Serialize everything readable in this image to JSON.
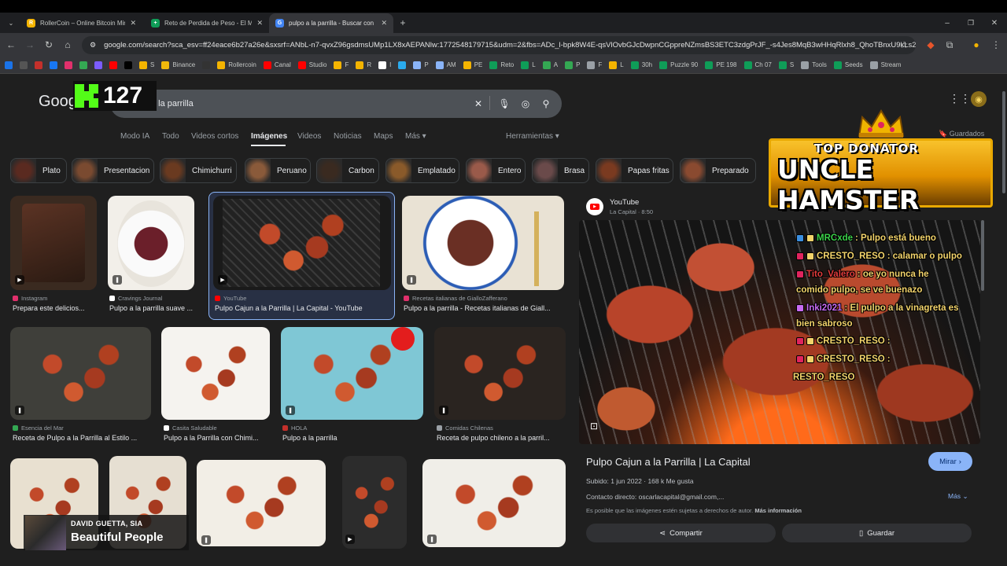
{
  "browser": {
    "tabs": [
      {
        "title": "RollerCoin – Online Bitcoin Mining",
        "color": "#f4b400",
        "glyph": "R"
      },
      {
        "title": "Reto de Perdida de Peso - El M",
        "color": "#0f9d58",
        "glyph": "+"
      },
      {
        "title": "pulpo a la parrilla - Buscar con",
        "color": "#4285f4",
        "glyph": "G"
      }
    ],
    "url": "google.com/search?sca_esv=ff24eace6b27a26e&sxsrf=ANbL-n7-qvxZ96gsdmsUMp1LX8xAEPANlw:1772548179715&udm=2&fbs=ADc_l-bpk8W4E-qsVlOvbGJcDwpnCGppreNZmsBS3ETC3zdgPrJF_-s4Jes8MqB3wHHqRlxh8_QhoTBnxU9kLs26Wf...",
    "bookmarks": [
      {
        "label": "",
        "color": "#1a73e8"
      },
      {
        "label": "",
        "color": "#555"
      },
      {
        "label": "",
        "color": "#c4302b"
      },
      {
        "label": "",
        "color": "#1877f2"
      },
      {
        "label": "",
        "color": "#e1306c"
      },
      {
        "label": "",
        "color": "#34a853"
      },
      {
        "label": "",
        "color": "#7b5cff"
      },
      {
        "label": "",
        "color": "#ff0000"
      },
      {
        "label": "",
        "color": "#000"
      },
      {
        "label": "S",
        "color": "#f4b400"
      },
      {
        "label": "Binance",
        "color": "#f0b90b"
      },
      {
        "label": "",
        "color": "#333"
      },
      {
        "label": "Rollercoin",
        "color": "#f4b400"
      },
      {
        "label": "Canal",
        "color": "#ff0000"
      },
      {
        "label": "Studio",
        "color": "#ff0000"
      },
      {
        "label": "F",
        "color": "#f4b400"
      },
      {
        "label": "R",
        "color": "#f4b400"
      },
      {
        "label": "I",
        "color": "#ffffff"
      },
      {
        "label": "",
        "color": "#2aabee"
      },
      {
        "label": "P",
        "color": "#8ab4f8"
      },
      {
        "label": "AM",
        "color": "#8ab4f8"
      },
      {
        "label": "PE",
        "color": "#f4b400"
      },
      {
        "label": "Reto",
        "color": "#0f9d58"
      },
      {
        "label": "L",
        "color": "#0f9d58"
      },
      {
        "label": "A",
        "color": "#34a853"
      },
      {
        "label": "P",
        "color": "#34a853"
      },
      {
        "label": "F",
        "color": "#9aa0a6"
      },
      {
        "label": "L",
        "color": "#f4b400"
      },
      {
        "label": "30h",
        "color": "#0f9d58"
      },
      {
        "label": "Puzzle 90",
        "color": "#0f9d58"
      },
      {
        "label": "PE 198",
        "color": "#0f9d58"
      },
      {
        "label": "Ch 07",
        "color": "#0f9d58"
      },
      {
        "label": "S",
        "color": "#0f9d58"
      },
      {
        "label": "Tools",
        "color": "#9aa0a6"
      },
      {
        "label": "Seeds",
        "color": "#0f9d58"
      },
      {
        "label": "Stream",
        "color": "#9aa0a6"
      }
    ]
  },
  "google": {
    "logo": "Goog",
    "query": "pulpo a la parrilla",
    "tabs": [
      "Modo IA",
      "Todo",
      "Videos cortos",
      "Imágenes",
      "Videos",
      "Noticias",
      "Maps",
      "Más ▾"
    ],
    "tools": "Herramientas ▾",
    "saved": "Guardados",
    "chips": [
      "Plato",
      "Presentacion",
      "Chimichurri",
      "Peruano",
      "Carbon",
      "Emplatado",
      "Entero",
      "Brasa",
      "Papas fritas",
      "Preparado"
    ]
  },
  "results": [
    {
      "source": "Instagram",
      "caption": "Prepara este delicios...",
      "src_color": "#e1306c"
    },
    {
      "source": "Cravings Journal",
      "caption": "Pulpo a la parrilla suave ...",
      "src_color": "#ffffff"
    },
    {
      "source": "YouTube",
      "caption": "Pulpo Cajun a la Parrilla | La Capital - YouTube",
      "src_color": "#ff0000"
    },
    {
      "source": "Recetas italianas de GialloZafferano",
      "caption": "Pulpo a la parrilla - Recetas italianas de Giall...",
      "src_color": "#e1306c"
    },
    {
      "source": "Esencia del Mar",
      "caption": "Receta de Pulpo a la Parrilla al Estilo ...",
      "src_color": "#34a853"
    },
    {
      "source": "Casita Saludable",
      "caption": "Pulpo a la Parrilla con Chimi...",
      "src_color": "#ffffff"
    },
    {
      "source": "HOLA",
      "caption": "Pulpo a la parrilla",
      "src_color": "#c4302b"
    },
    {
      "source": "Comidas Chilenas",
      "caption": "Receta de pulpo chileno a la parril...",
      "src_color": "#9aa0a6"
    }
  ],
  "panel": {
    "source": "YouTube",
    "channel": "La Capital · 8:50",
    "title": "Pulpo Cajun a la Parrilla | La Capital",
    "visit": "Mirar",
    "meta": "Subido:  1 jun 2022  ·  168 k Me gusta",
    "contact": "Contacto directo: oscarlacapital@gmail.com,...",
    "more": "Más",
    "disclaimer": "Es posible que las imágenes estén sujetas a derechos de autor.",
    "disclaimer_link": "Más información",
    "share": "Compartir",
    "save": "Guardar"
  },
  "chat": [
    {
      "user": "MRCxde",
      "msg": ": Pulpo está bueno",
      "user_color": "#3bd14a"
    },
    {
      "user": "CRESTO_RESO",
      "msg": ": calamar o pulpo",
      "user_color": "#f2d36b"
    },
    {
      "user": "Tito_Valero",
      "msg": ": oe yo nunca he",
      "user_color": "#e33b3b"
    },
    {
      "user": "",
      "msg": "comido pulpo, se ve buenazo",
      "user_color": "#f2d36b"
    },
    {
      "user": "Inki2021",
      "msg": ": El pulpo a la vinagreta es",
      "user_color": "#c86bf2"
    },
    {
      "user": "",
      "msg": "bien sabroso",
      "user_color": "#f2d36b"
    },
    {
      "user": "CRESTO_RESO",
      "msg": ":",
      "user_color": "#f2d36b"
    },
    {
      "user": "CRESTO_RESO",
      "msg": ":",
      "user_color": "#f2d36b"
    },
    {
      "user": "",
      "msg": "RESTO_RESO",
      "user_color": "#f2d36b"
    }
  ],
  "overlay": {
    "kick_count": "127",
    "donator_label": "TOP DONATOR",
    "donator_name": "UNCLE HAMSTER",
    "music_artist": "DAVID GUETTA, SIA",
    "music_title": "Beautiful People"
  }
}
